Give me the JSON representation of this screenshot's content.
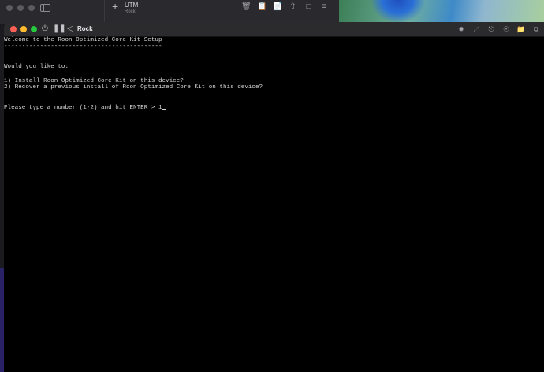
{
  "background_window": {
    "title": "UTM",
    "subtitle": "Rock",
    "icons": [
      "sidebar-toggle-icon",
      "plus-icon",
      "trash-icon",
      "clipboard-icon",
      "document-icon",
      "share-icon",
      "square-icon",
      "sliders-icon"
    ]
  },
  "vm_window": {
    "title": "Rock",
    "controls": [
      "power-icon",
      "pause-icon",
      "back-icon"
    ],
    "toolbar_icons": [
      "display-icon",
      "resize-icon",
      "usb-icon",
      "disc-icon",
      "folder-icon",
      "windows-icon"
    ]
  },
  "console": {
    "welcome": "Welcome to the Roon Optimized Core Kit Setup",
    "underline": "--------------------------------------------",
    "question": "Would you like to:",
    "option_1": "1) Install Roon Optimized Core Kit on this device?",
    "option_2": "2) Recover a previous install of Roon Optimized Core Kit on this device?",
    "prompt": "Please type a number (1-2) and hit ENTER > ",
    "input_value": "1"
  },
  "colors": {
    "close": "#fe5f57",
    "minimize": "#febc2e",
    "maximize": "#28c840",
    "console_text": "#d6d6d6",
    "console_bg": "#000000"
  }
}
